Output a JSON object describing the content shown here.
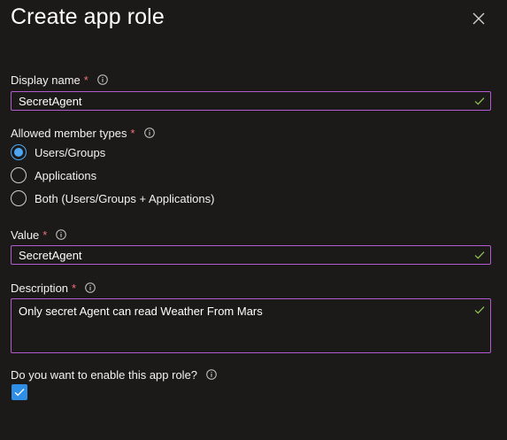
{
  "panel": {
    "title": "Create app role"
  },
  "display_name": {
    "label": "Display name",
    "required_mark": "*",
    "value": "SecretAgent"
  },
  "allowed_member_types": {
    "label": "Allowed member types",
    "required_mark": "*",
    "options": [
      {
        "label": "Users/Groups",
        "selected": true
      },
      {
        "label": "Applications",
        "selected": false
      },
      {
        "label": "Both (Users/Groups + Applications)",
        "selected": false
      }
    ]
  },
  "value_field": {
    "label": "Value",
    "required_mark": "*",
    "value": "SecretAgent"
  },
  "description": {
    "label": "Description",
    "required_mark": "*",
    "value": "Only secret Agent can read Weather From Mars"
  },
  "enable": {
    "label": "Do you want to enable this app role?",
    "checked": true
  },
  "colors": {
    "background": "#1b1a19",
    "field_border": "#b55bd1",
    "required": "#f1707b",
    "valid_check": "#92c353",
    "accent": "#2f8fe6"
  },
  "icons": {
    "close": "close-icon",
    "info": "info-icon",
    "valid": "checkmark-icon"
  }
}
